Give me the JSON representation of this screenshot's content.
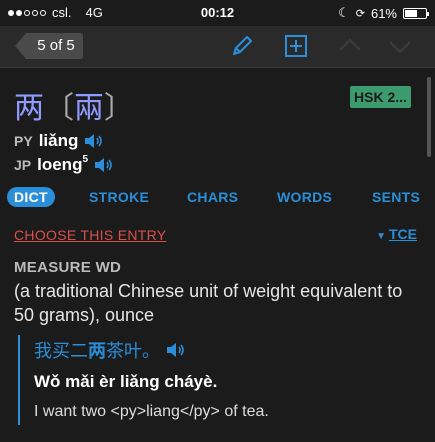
{
  "status": {
    "carrier": "csl.",
    "network": "4G",
    "time": "00:12",
    "battery": "61%",
    "battery_level": 0.61
  },
  "toolbar": {
    "pager": "5 of 5"
  },
  "entry": {
    "simplified": "两",
    "traditional": "兩",
    "hsk": "HSK 2...",
    "py_tag": "PY",
    "pinyin": "liǎng",
    "jp_tag": "JP",
    "jyutping": "loeng",
    "jyutping_tone": "5"
  },
  "tabs": [
    "DICT",
    "STROKE",
    "CHARS",
    "WORDS",
    "SENTS"
  ],
  "choose_label": "CHOOSE THIS ENTRY",
  "source": "TCE",
  "sense": {
    "label": "MEASURE WD",
    "definition": "(a traditional Chinese unit of weight equivalent to 50 grams), ounce",
    "example_hanzi_pre": "我买二",
    "example_hanzi_bold": "两",
    "example_hanzi_post": "茶叶。",
    "example_pinyin_pre": "Wǒ mǎi èr ",
    "example_pinyin_bold": "liǎng",
    "example_pinyin_post": " cháyè.",
    "example_english": "I want two <py>liang</py> of tea."
  },
  "colors": {
    "accent": "#2b8ed8",
    "headword": "#8f9bff",
    "hsk": "#3c9b6d",
    "choose": "#d8504a"
  }
}
